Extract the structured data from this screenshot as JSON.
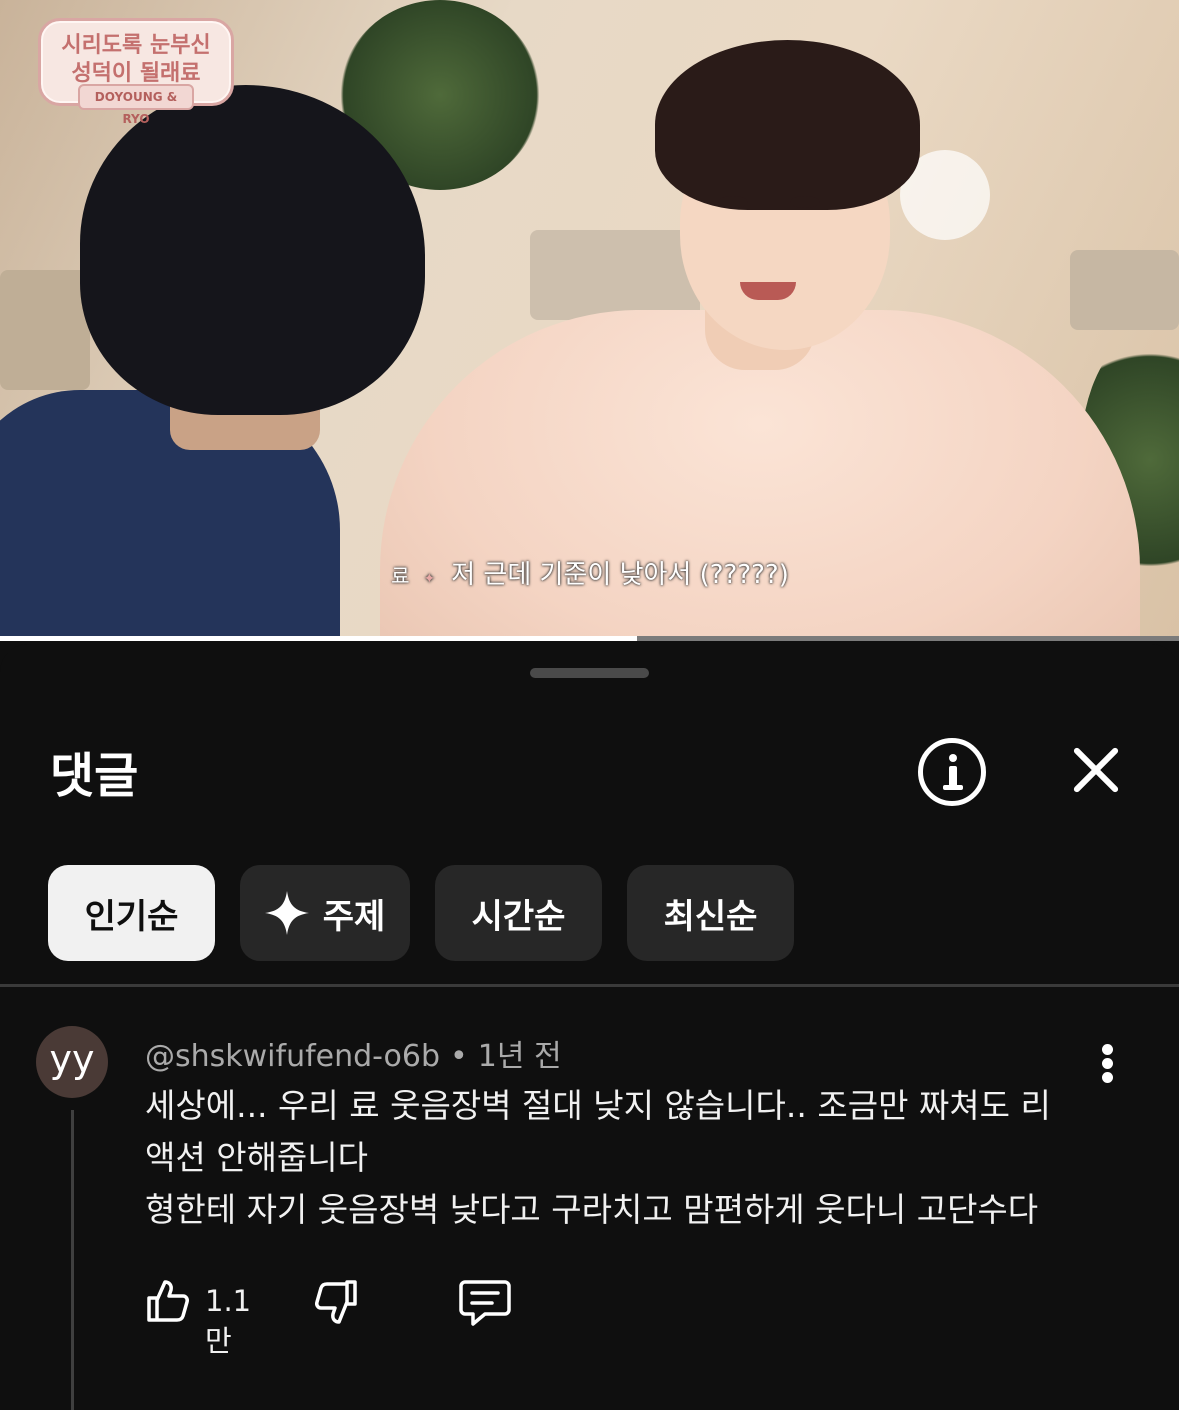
{
  "video": {
    "logo_line1": "시리도록 눈부신",
    "logo_line2": "성덕이 될래료",
    "logo_sub": "DOYOUNG & RYO",
    "subtitle_speaker": "료",
    "subtitle_text": "저 근데 기준이 낮아서 (?????)",
    "progress": 0.54
  },
  "sheet": {
    "title": "댓글",
    "info_icon": "info-icon",
    "close_icon": "close-icon"
  },
  "chips": [
    {
      "label": "인기순",
      "active": true
    },
    {
      "label": "주제",
      "icon": "sparkle-icon",
      "active": false
    },
    {
      "label": "시간순",
      "active": false
    },
    {
      "label": "최신순",
      "active": false
    }
  ],
  "comment": {
    "avatar_text": "yy",
    "author": "@shskwifufend-o6b",
    "separator": "•",
    "time": "1년 전",
    "lines": [
      "세상에... 우리 료 웃음장벽 절대 낮지 않습니다.. 조금만 짜쳐도 리",
      "액션 안해줍니다",
      "형한테 자기 웃음장벽 낮다고 구라치고 맘편하게 웃다니 고단수다"
    ],
    "like_count": "1.1만"
  },
  "colors": {
    "background": "#0f0f0f",
    "chip": "#272727",
    "chip_active": "#f1f1f1",
    "secondary_text": "#aaaaaa"
  }
}
